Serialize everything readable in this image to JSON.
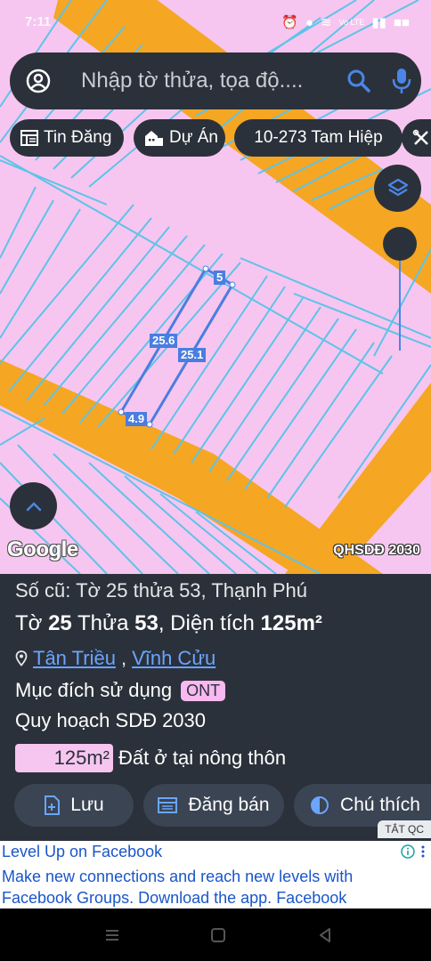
{
  "status_bar": {
    "time": "7:11",
    "signal_text": "Vo LTE",
    "battery": "■■"
  },
  "search": {
    "placeholder": "Nhập tờ thửa, tọa độ...."
  },
  "chips": [
    {
      "label": "Tin Đăng",
      "icon": "newspaper-icon"
    },
    {
      "label": "Dự Án",
      "icon": "building-icon"
    },
    {
      "label": "10-273 Tam Hiệp",
      "icon": ""
    },
    {
      "label": "",
      "icon": "tools-icon"
    }
  ],
  "map": {
    "labels": {
      "top": "5",
      "left_side": "25.6",
      "right_side": "25.1",
      "bottom": "4.9"
    },
    "attribution": "Google",
    "overlay": "QHSDĐ 2030",
    "colors": {
      "land": "#f6c6f0",
      "road": "#f5a623",
      "grid": "#5ec3e8",
      "parcel": "#4a7de0"
    }
  },
  "panel": {
    "old_info": "Số cũ: Tờ 25 thửa 53, Thạnh Phú",
    "sheet_label": "Tờ",
    "sheet": "25",
    "parcel_label": "Thửa",
    "parcel": "53",
    "area_label": ", Diện tích",
    "area": "125m²",
    "commune": "Tân Triều",
    "district": "Vĩnh Cửu",
    "purpose_label": "Mục đích sử dụng",
    "purpose_code": "ONT",
    "plan": "Quy hoạch SDĐ 2030",
    "area_badge": "125m²",
    "land_desc": "Đất ở tại nông thôn"
  },
  "actions": {
    "save": "Lưu",
    "post": "Đăng bán",
    "legend": "Chú thích"
  },
  "ad": {
    "tag": "TẮT QC",
    "title": "Level Up on Facebook",
    "body": "Make new connections and reach new levels with Facebook Groups. Download the app. Facebook"
  }
}
